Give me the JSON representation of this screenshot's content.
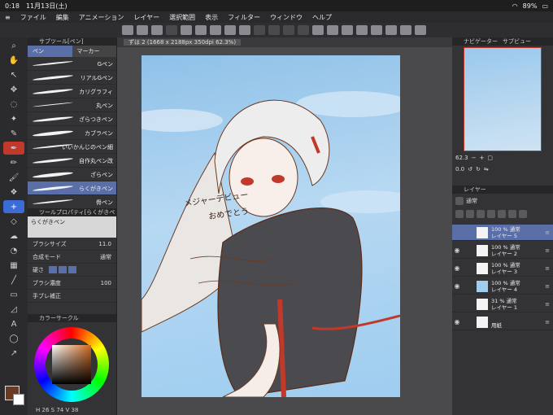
{
  "status": {
    "time": "0:18",
    "date": "11月13日(土)",
    "battery": "89%"
  },
  "menu": [
    "ファイル",
    "編集",
    "アニメーション",
    "レイヤー",
    "選択範囲",
    "表示",
    "フィルター",
    "ウィンドウ",
    "ヘルプ"
  ],
  "subtool": {
    "header": "サブツール[ペン]",
    "tabs": [
      "ペン",
      "マーカー"
    ],
    "pens": [
      "Gペン",
      "リアルGペン",
      "カリグラフィ",
      "丸ペン",
      "ざらつきペン",
      "カブラペン",
      "いいかんじのペン細",
      "自作丸ペン改",
      "ざらペン",
      "らくがきペン",
      "骨ペン"
    ],
    "selected": "らくがきペン"
  },
  "toolprop": {
    "header": "ツールプロパティ[らくがきペン]",
    "current": "らくがきペン",
    "brush_size_label": "ブラシサイズ",
    "brush_size": "11.0",
    "blend_label": "合成モード",
    "blend": "通常",
    "hardness_label": "硬さ",
    "density_label": "ブラシ濃度",
    "density": "100",
    "stabilize_label": "手ブレ補正"
  },
  "color": {
    "header": "カラーサークル",
    "h": "26",
    "s": "74",
    "v": "38"
  },
  "document": {
    "tab": "ずは 2 (1668 x 2188px 350dpi 62.3%)"
  },
  "art": {
    "caption_line1": "メジャーデビュー",
    "caption_line2": "おめでとう"
  },
  "navigator": {
    "tabs": [
      "ナビゲーター",
      "サブビュー"
    ],
    "zoom": "62.3",
    "angle": "0.0"
  },
  "layers": {
    "tabs": [
      "レイヤー"
    ],
    "blend": "通常",
    "items": [
      {
        "opacity": "100 %",
        "mode": "通常",
        "name": "レイヤー 5",
        "selected": true
      },
      {
        "opacity": "100 %",
        "mode": "通常",
        "name": "レイヤー 2",
        "selected": false
      },
      {
        "opacity": "100 %",
        "mode": "通常",
        "name": "レイヤー 3",
        "selected": false
      },
      {
        "opacity": "100 %",
        "mode": "通常",
        "name": "レイヤー 4",
        "selected": false
      },
      {
        "opacity": "31 %",
        "mode": "通常",
        "name": "レイヤー 1",
        "selected": false
      },
      {
        "opacity": "",
        "mode": "",
        "name": "用紙",
        "selected": false
      }
    ]
  },
  "colors": {
    "accent": "#5a6ea8",
    "active_tool": "#c0392b",
    "brush_color": "#6b3a22"
  }
}
